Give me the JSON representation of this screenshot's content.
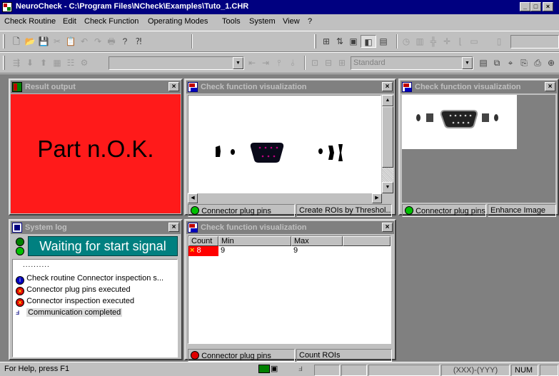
{
  "app": {
    "title": "NeuroCheck - C:\\Program Files\\NCheck\\Examples\\Tuto_1.CHR"
  },
  "menu": [
    "Check Routine",
    "Edit",
    "Check Function",
    "Operating Modes",
    "Tools",
    "System",
    "View",
    "?"
  ],
  "toolbar2": {
    "combo1_value": "",
    "combo2_value": "Standard"
  },
  "windows": {
    "result": {
      "title": "Result output",
      "text": "Part n.O.K.",
      "color": "#ff1a1a"
    },
    "viz1": {
      "title": "Check function visualization",
      "status_name": "Connector plug pins",
      "status_func": "Create ROIs by Threshol..."
    },
    "viz2": {
      "title": "Check function visualization",
      "status_name": "Connector plug pins",
      "status_func": "Enhance Image"
    },
    "syslog": {
      "title": "System log",
      "banner": "Waiting for start signal",
      "dots": "..........",
      "entries": [
        {
          "icon": "info-icon",
          "text": "Check routine Connector inspection s..."
        },
        {
          "icon": "error-icon",
          "text": "Connector plug pins executed"
        },
        {
          "icon": "error-icon",
          "text": "Connector inspection executed"
        },
        {
          "icon": "communication-icon",
          "text": "Communication completed"
        }
      ]
    },
    "viz3": {
      "title": "Check function visualization",
      "headers": [
        "Count",
        "Min",
        "Max"
      ],
      "row": [
        "8",
        "9",
        "9"
      ],
      "status_name": "Connector plug pins",
      "status_func": "Count ROIs"
    }
  },
  "statusbar": {
    "help": "For Help, press F1",
    "coords": "(XXX)-(YYY)",
    "num": "NUM"
  },
  "colors": {
    "title_active": "#000080",
    "caption_inactive": "#808080",
    "banner_bg": "#008080",
    "banner_fg": "#ffffff",
    "status_green": "#00c000",
    "status_red": "#e00000",
    "error_cell": "#ff0000"
  }
}
